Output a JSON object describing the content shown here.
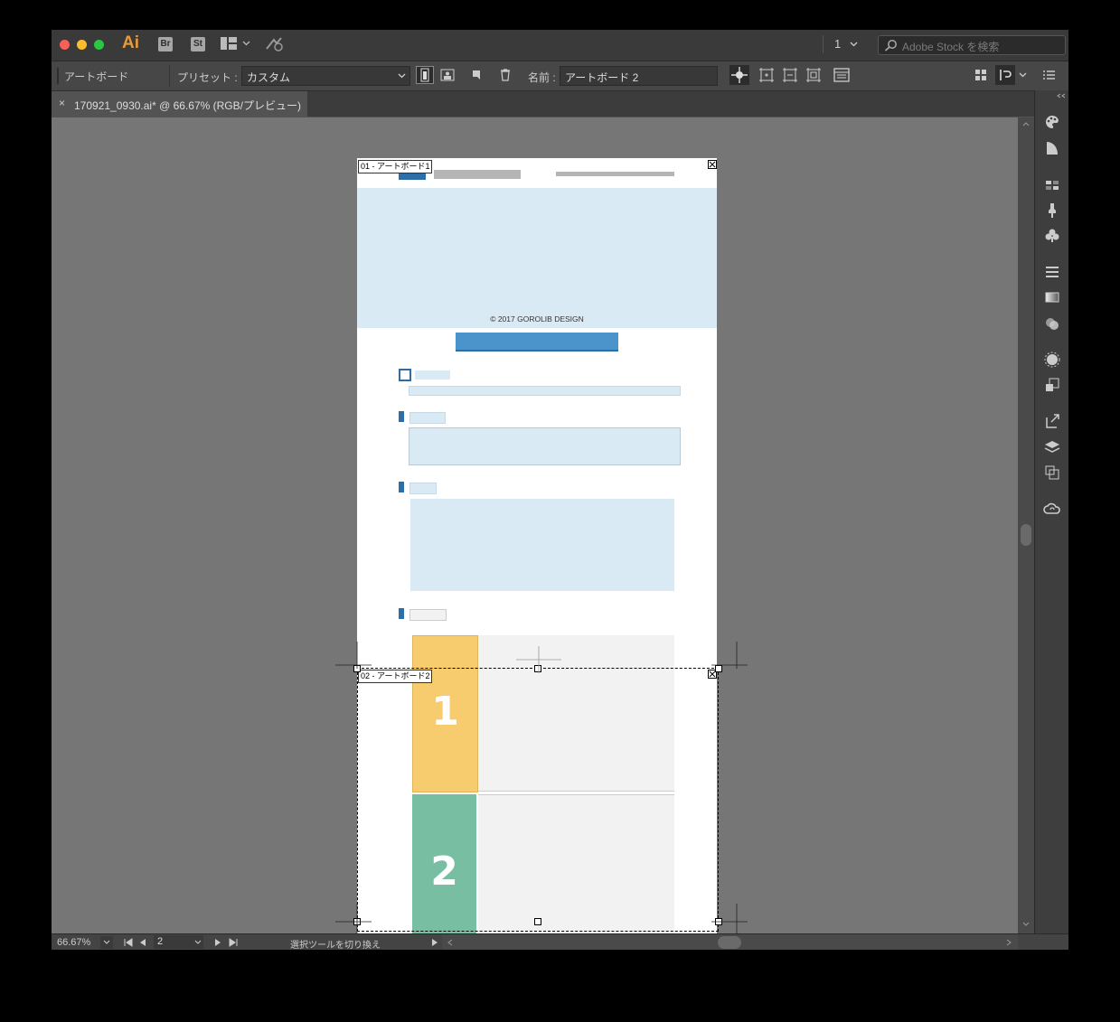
{
  "app": {
    "logo": "Ai",
    "bridge": "Br",
    "stock": "St"
  },
  "titlebar": {
    "page_selector": "1",
    "search_placeholder": "Adobe Stock を検索"
  },
  "control_bar": {
    "mode_label": "アートボード",
    "preset_label": "プリセット :",
    "preset_value": "カスタム",
    "name_label": "名前 :",
    "name_value": "アートボード 2"
  },
  "document_tab": {
    "close": "×",
    "title": "170921_0930.ai* @ 66.67% (RGB/プレビュー)"
  },
  "artboards": {
    "ab1_label": "01 - アートボード1",
    "ab2_label": "02 - アートボード2",
    "copyright": "© 2017 GOROLIB DESIGN",
    "step1": "1",
    "step2": "2"
  },
  "colors": {
    "accent_blue": "#2e6ea6",
    "light_blue": "#daeaf4",
    "step1_color": "#f7cc6e",
    "step2_color": "#78bea2"
  },
  "status_bar": {
    "zoom": "66.67%",
    "artboard_number": "2",
    "status_text": "選択ツールを切り換え"
  }
}
